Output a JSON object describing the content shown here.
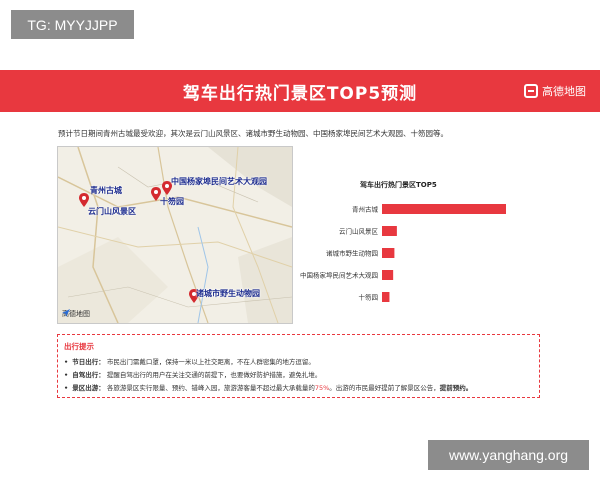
{
  "tg_badge": "TG: MYYJJPP",
  "banner": {
    "title": "驾车出行热门景区TOP5预测",
    "logo_text": "高德地图",
    "color": "#e8383f"
  },
  "intro": "预计节日期间青州古城最受欢迎，其次是云门山风景区、诸城市野生动物园、中国杨家埠民间艺术大观园、十笏园等。",
  "map": {
    "labels": {
      "qingzhou": "青州古城",
      "yunmenshan": "云门山风景区",
      "yangjiabu": "中国杨家埠民间艺术大观园",
      "shihu": "十笏园",
      "zhucheng": "诸城市野生动物园"
    },
    "logo_text": "高德地图"
  },
  "chart_data": {
    "type": "bar",
    "orientation": "horizontal",
    "title": "驾车出行热门景区TOP5",
    "categories": [
      "青州古城",
      "云门山风景区",
      "诸城市野生动物园",
      "中国杨家埠民间艺术大观园",
      "十笏园"
    ],
    "values": [
      100,
      12,
      10,
      9,
      6
    ],
    "bar_color": "#e8383f",
    "grid": false
  },
  "tips": {
    "title": "出行提示",
    "items": [
      {
        "head": "节日出行：",
        "text": "市民出门需戴口罩，保持一米以上社交距离，不在人群密集的地方逗留。"
      },
      {
        "head": "自驾出行：",
        "text": "提醒自驾出行的用户在关注交通的前提下，也要做好防护措施，避免扎堆。"
      },
      {
        "head": "景区出游：",
        "text_a": "各旅游景区实行限量、预约、错峰入园，旅游游客量不超过最大承载量的",
        "highlight": "75%",
        "text_b": "。出游的市民最好提前了解景区公告，",
        "bold": "提前预约。"
      }
    ]
  },
  "watermark": "www.yanghang.org"
}
